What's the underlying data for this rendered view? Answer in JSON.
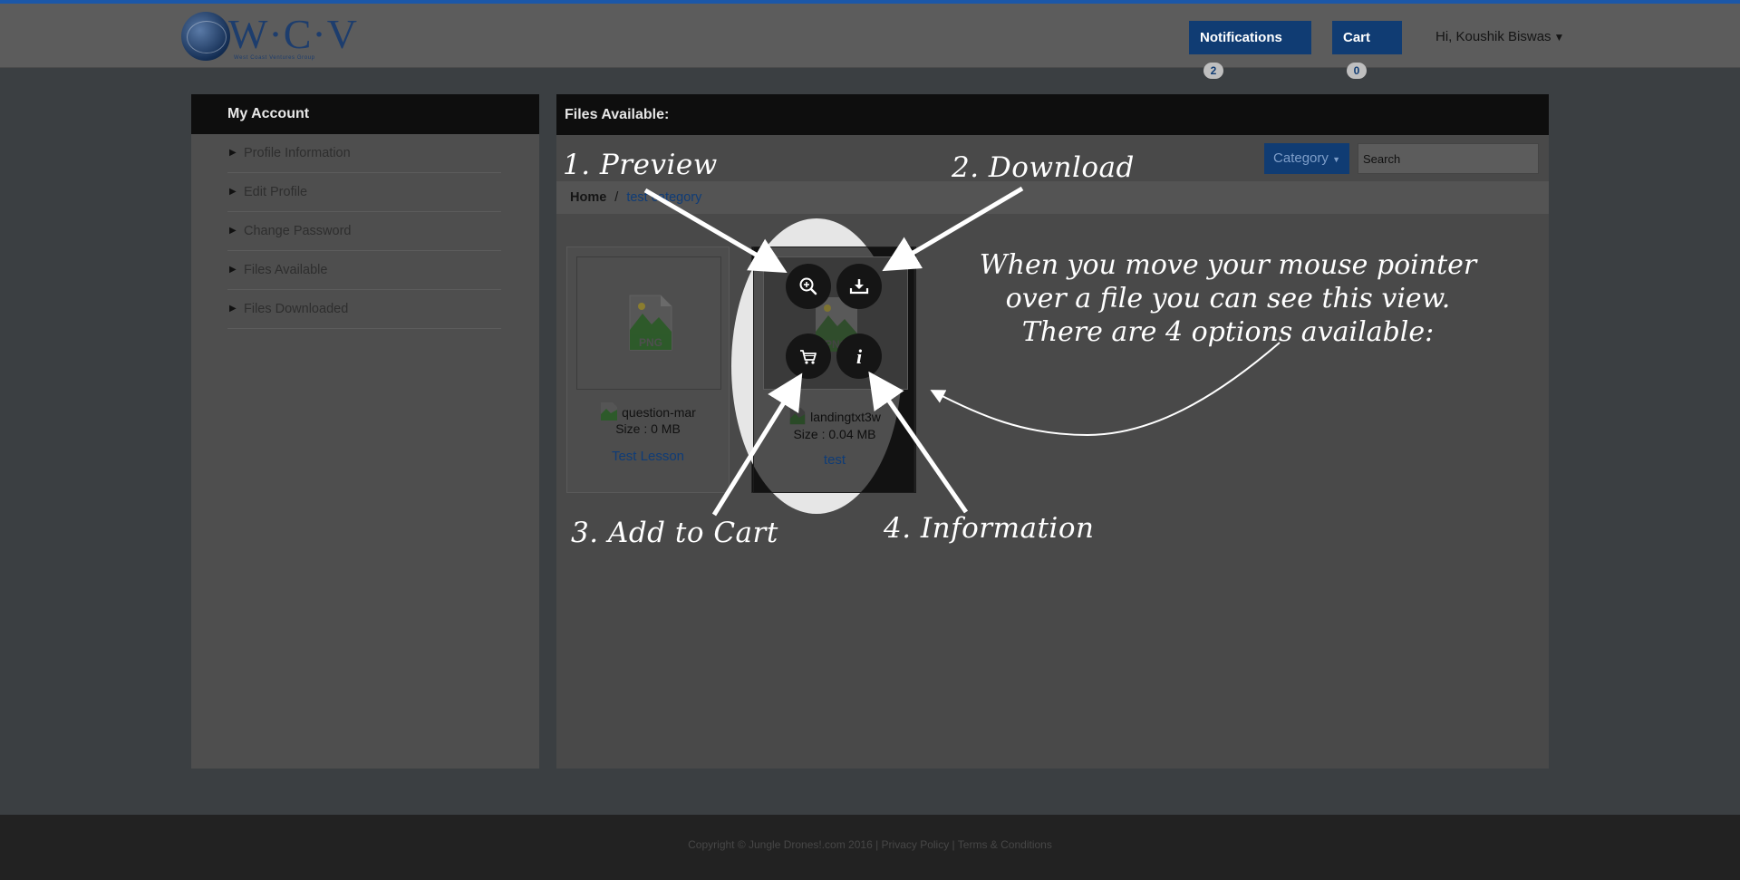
{
  "header": {
    "logo_text": "W·C·V",
    "logo_sub": "West Coast Ventures Group",
    "notifications_label": "Notifications",
    "notifications_count": "2",
    "cart_label": "Cart",
    "cart_count": "0",
    "user_greeting": "Hi, Koushik Biswas"
  },
  "sidebar": {
    "title": "My Account",
    "items": [
      {
        "label": "Profile Information"
      },
      {
        "label": "Edit Profile"
      },
      {
        "label": "Change Password"
      },
      {
        "label": "Files Available"
      },
      {
        "label": "Files Downloaded"
      }
    ]
  },
  "main": {
    "title": "Files Available:",
    "category_label": "Category",
    "search_placeholder": "Search",
    "breadcrumb": {
      "home": "Home",
      "separator": "/",
      "current": "test category"
    },
    "files": [
      {
        "name": "question-mar",
        "size": "Size : 0 MB",
        "category": "Test Lesson",
        "icon": "png-file-icon"
      },
      {
        "name": "landingtxt3w",
        "size": "Size : 0.04 MB",
        "category": "test",
        "icon": "png-file-icon"
      }
    ]
  },
  "annotations": {
    "preview": "1. Preview",
    "download": "2. Download",
    "add_to_cart": "3. Add to Cart",
    "information": "4. Information",
    "note_line1": "When you move your mouse pointer",
    "note_line2": "over a file you can see this view.",
    "note_line3": "There are 4 options available:"
  },
  "overlay_buttons": [
    "zoom-in-icon",
    "download-icon",
    "cart-icon",
    "info-icon"
  ],
  "footer": {
    "copyright": "Copyright © Jungle Drones!.com 2016 | Privacy Policy | Terms & Conditions"
  },
  "colors": {
    "brand_blue": "#103c73",
    "top_accent": "#1b57a8",
    "panel_header": "#0e0e0e"
  }
}
